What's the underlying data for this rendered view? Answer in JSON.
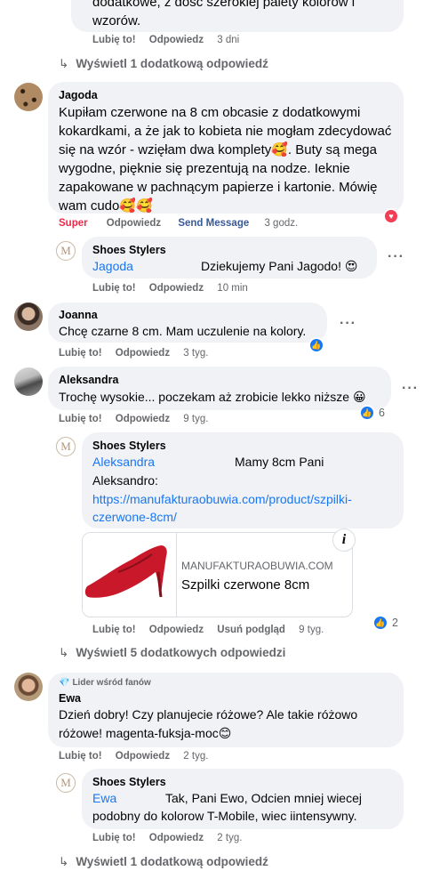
{
  "top_comment": {
    "text_partial": "dodatkowe, z dość szerokiej palety kolorów i",
    "text_last": "wzorów.",
    "like": "Lubię to!",
    "reply": "Odpowiedz",
    "time": "3 dni"
  },
  "view_more_1": "Wyświetl 1 dodatkową odpowiedź",
  "jagoda": {
    "name": "Jagoda",
    "lines": [
      "Kupiłam czerwone na 8 cm obcasie z dodatkowymi",
      "kokardkami, a że jak to kobieta nie mogłam zdecydować",
      "się na wzór - wzięłam dwa komplety🥰. Buty są mega",
      "wygodne, pięknie się prezentują na nodze. Ieknie",
      "zapakowane w pachnącym papierze i kartonie. Mówię",
      "wam cudo🥰🥰"
    ],
    "reaction_label": "Super",
    "reply": "Odpowiedz",
    "send_message": "Send Message",
    "time": "3 godz."
  },
  "reply_jagoda": {
    "name": "Shoes Stylers",
    "mention": "Jagoda",
    "text": "Dziekujemy Pani Jagodo! 😍",
    "like": "Lubię to!",
    "reply": "Odpowiedz",
    "time": "10 min"
  },
  "joanna": {
    "name": "Joanna",
    "text": "Chcę czarne 8 cm. Mam uczulenie na kolory.",
    "like": "Lubię to!",
    "reply": "Odpowiedz",
    "time": "3 tyg."
  },
  "aleksandra": {
    "name": "Aleksandra",
    "text": "Trochę wysokie... poczekam aż zrobicie lekko niższe 😀",
    "like": "Lubię to!",
    "reply": "Odpowiedz",
    "time": "9 tyg.",
    "reaction_count": "6"
  },
  "reply_aleksandra": {
    "name": "Shoes Stylers",
    "mention": "Aleksandra",
    "text_after_mention": "Mamy 8cm Pani",
    "line2": "Aleksandro:",
    "link_line1": "https://manufakturaobuwia.com/product/szpilki-",
    "link_line2": "czerwone-8cm/",
    "preview_domain": "MANUFAKTURAOBUWIA.COM",
    "preview_title": "Szpilki czerwone 8cm",
    "info": "i",
    "like": "Lubię to!",
    "reply": "Odpowiedz",
    "remove_preview": "Usuń podgląd",
    "time": "9 tyg.",
    "reaction_count": "2"
  },
  "view_more_5": "Wyświetl 5 dodatkowych odpowiedzi",
  "ewa": {
    "badge": "Lider wśród fanów",
    "name": "Ewa",
    "lines": [
      "Dzień dobry! Czy planujecie różowe? Ale takie różowo",
      "różowe! magenta-fuksja-moc😊"
    ],
    "like": "Lubię to!",
    "reply": "Odpowiedz",
    "time": "2 tyg."
  },
  "reply_ewa": {
    "name": "Shoes Stylers",
    "mention": "Ewa",
    "text_after_mention": "Tak, Pani Ewo, Odcien mniej wiecej",
    "line2": "podobny do kolorow T-Mobile, wiec iintensywny.",
    "like": "Lubię to!",
    "reply": "Odpowiedz",
    "time": "2 tyg."
  },
  "view_more_last": "Wyświetl 1 dodatkową odpowiedź",
  "more_glyph": "···",
  "brand_glyph": "M",
  "colors": {
    "bubble": "#f0f2f5",
    "link": "#1877f2",
    "secondary": "#65676b",
    "super": "#f02849"
  }
}
